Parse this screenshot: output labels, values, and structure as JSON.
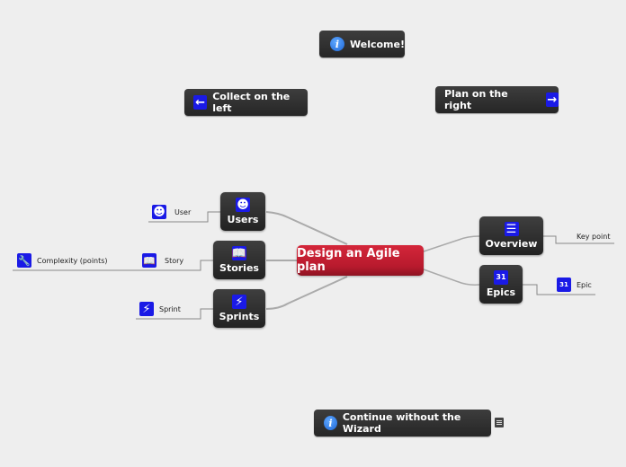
{
  "buttons": {
    "welcome": {
      "label": "Welcome!",
      "icon": "info-icon"
    },
    "collect_left": {
      "label": "Collect on the left",
      "icon": "arrow-left-icon"
    },
    "plan_right": {
      "label": "Plan on the right",
      "icon": "arrow-right-icon"
    },
    "continue": {
      "label": "Continue without the Wizard",
      "icon": "info-icon",
      "note_icon": "note-icon"
    }
  },
  "central_topic": {
    "label": "Design an Agile plan",
    "color": "#c41e32"
  },
  "left_nodes": [
    {
      "label": "Users",
      "icon": "user-icon",
      "children": [
        {
          "label": "User",
          "icon": "user-icon"
        }
      ]
    },
    {
      "label": "Stories",
      "icon": "book-icon",
      "children": [
        {
          "label": "Story",
          "icon": "book-icon",
          "children": [
            {
              "label": "Complexity (points)",
              "icon": "wrench-icon"
            }
          ]
        }
      ]
    },
    {
      "label": "Sprints",
      "icon": "sprint-icon",
      "children": [
        {
          "label": "Sprint",
          "icon": "sprint-icon"
        }
      ]
    }
  ],
  "right_nodes": [
    {
      "label": "Overview",
      "icon": "list-icon",
      "children": [
        {
          "label": "Key point"
        }
      ]
    },
    {
      "label": "Epics",
      "icon": "calendar-icon",
      "children": [
        {
          "label": "Epic",
          "icon": "calendar-icon",
          "day": "31"
        }
      ]
    }
  ],
  "colors": {
    "icon_blue": "#1a1ae6",
    "node_dark": "#2e2e2e",
    "background": "#eeeeee"
  }
}
